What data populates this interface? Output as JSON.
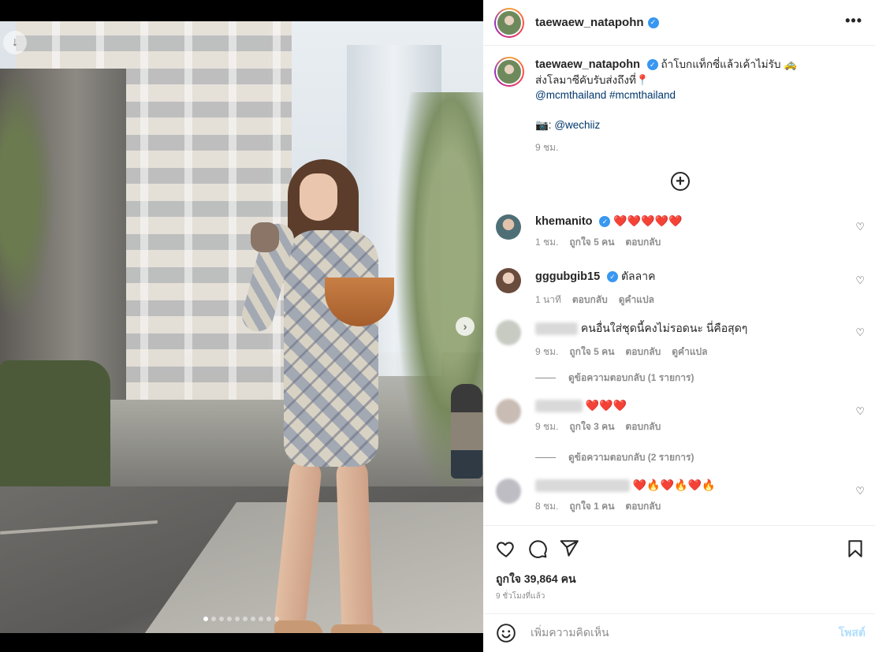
{
  "post": {
    "username": "taewaew_natapohn",
    "verified_icon": "verified-badge-icon",
    "more_icon": "more-options-icon",
    "caption": {
      "line1": "ถ้าโบกแท็กซี่แล้วเค้าไม่รับ 🚕",
      "line2": "ส่งโลมาซีคับรับส่งถึงที่📍",
      "mention_tag": "@mcmthailand #mcmthailand",
      "camera_emoji": "📷:",
      "photographer": "@wechiiz",
      "time": "9 ชม."
    },
    "media": {
      "slide_count": 10,
      "active_slide": 1,
      "download_icon": "arrow-down-icon",
      "next_icon": "chevron-right-icon"
    }
  },
  "comments": [
    {
      "username": "khemanito",
      "verified": true,
      "text": "❤️❤️❤️❤️❤️",
      "time": "1 ชม.",
      "likes": "ถูกใจ 5 คน",
      "reply": "ตอบกลับ",
      "translate": ""
    },
    {
      "username": "gggubgib15",
      "verified": true,
      "text": "ตัลลาค",
      "time": "1 นาที",
      "likes": "",
      "reply": "ตอบกลับ",
      "translate": "ดูคำแปล"
    },
    {
      "username": "",
      "verified": false,
      "text": "คนอื่นใส่ชุดนี้คงไม่รอดนะ นี่คือสุดๆ",
      "time": "9 ชม.",
      "likes": "ถูกใจ 5 คน",
      "reply": "ตอบกลับ",
      "translate": "ดูคำแปล",
      "view_replies": "ดูข้อความตอบกลับ (1 รายการ)"
    },
    {
      "username": "",
      "verified": false,
      "text": "❤️❤️❤️",
      "time": "9 ชม.",
      "likes": "ถูกใจ 3 คน",
      "reply": "ตอบกลับ",
      "translate": "",
      "view_replies": "ดูข้อความตอบกลับ (2 รายการ)"
    },
    {
      "username": "",
      "verified": false,
      "text": "❤️🔥❤️🔥❤️🔥",
      "time": "8 ชม.",
      "likes": "ถูกใจ 1 คน",
      "reply": "ตอบกลับ",
      "translate": ""
    }
  ],
  "actions": {
    "like_icon": "heart-icon",
    "comment_icon": "comment-bubble-icon",
    "share_icon": "paper-plane-icon",
    "save_icon": "bookmark-icon",
    "likes_text": "ถูกใจ 39,864 คน",
    "posted_ago": "9 ชั่วโมงที่แล้ว"
  },
  "add_comment": {
    "emoji_icon": "smiley-icon",
    "placeholder": "เพิ่มความคิดเห็น",
    "post_label": "โพสต์"
  },
  "colors": {
    "verified_blue": "#3897f0",
    "link_blue": "#00376b",
    "muted_gray": "#8e8e8e",
    "post_disabled": "#b2dffc",
    "heart_red": "#ed4956"
  }
}
